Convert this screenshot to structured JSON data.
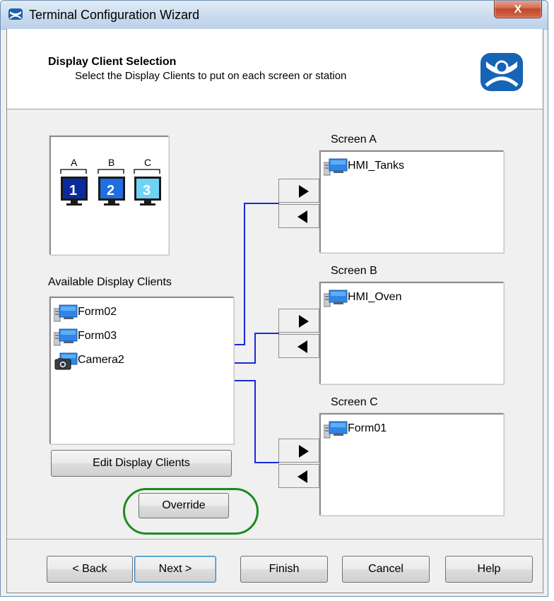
{
  "window": {
    "title": "Terminal Configuration Wizard",
    "close_label": "X"
  },
  "header": {
    "title": "Display Client Selection",
    "subtitle": "Select the Display Clients to put on each screen or station",
    "logo_icon": "thinmanager-logo-icon"
  },
  "preview": {
    "screens": [
      {
        "letter": "A",
        "number": "1",
        "color": "#0a2b9c"
      },
      {
        "letter": "B",
        "number": "2",
        "color": "#1f6fe0"
      },
      {
        "letter": "C",
        "number": "3",
        "color": "#6fd3f7"
      }
    ]
  },
  "available": {
    "label": "Available Display Clients",
    "items": [
      {
        "name": "Form02",
        "icon": "terminal-display-client-icon"
      },
      {
        "name": "Form03",
        "icon": "terminal-display-client-icon"
      },
      {
        "name": "Camera2",
        "icon": "camera-icon"
      }
    ],
    "edit_button": "Edit Display Clients",
    "override_button": "Override"
  },
  "screens": [
    {
      "label": "Screen A",
      "items": [
        {
          "name": "HMI_Tanks",
          "icon": "terminal-display-client-icon"
        }
      ]
    },
    {
      "label": "Screen B",
      "items": [
        {
          "name": "HMI_Oven",
          "icon": "terminal-display-client-icon"
        }
      ]
    },
    {
      "label": "Screen C",
      "items": [
        {
          "name": "Form01",
          "icon": "terminal-display-client-icon"
        }
      ]
    }
  ],
  "buttons": {
    "back": "< Back",
    "next": "Next >",
    "finish": "Finish",
    "cancel": "Cancel",
    "help": "Help"
  },
  "colors": {
    "wire": "#1a28d8",
    "highlight_ring": "#1e8a1e",
    "title_bar": "#c9dbee"
  }
}
